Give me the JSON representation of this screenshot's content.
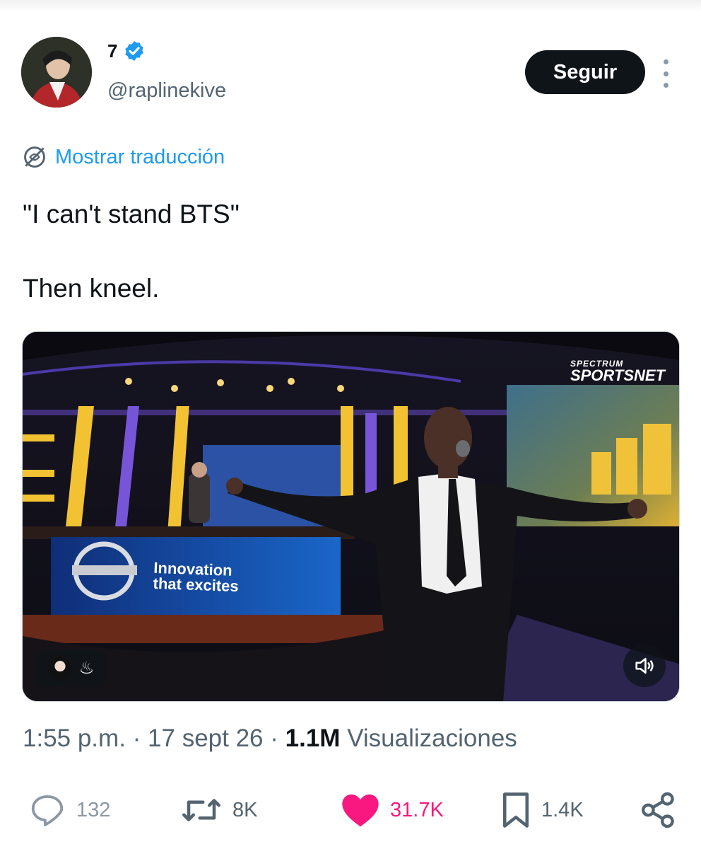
{
  "author": {
    "display_name": "7",
    "handle": "@raplinekive",
    "verified": true,
    "avatar_icon": "profile-avatar"
  },
  "follow_label": "Seguir",
  "translate_label": "Mostrar traducción",
  "tweet": {
    "line1": "\"I can't stand BTS\"",
    "line2": "Then kneel."
  },
  "media": {
    "brand_top": "SPECTRUM",
    "brand_bottom": "SPORTSNET",
    "desk_line1": "Innovation",
    "desk_line2": "that excites",
    "badge_emoji": "♨",
    "mute_icon": "speaker-muted-icon"
  },
  "meta": {
    "time": "1:55 p.m.",
    "date": "17 sept 26",
    "views_count": "1.1M",
    "views_label": "Visualizaciones",
    "separator": "·"
  },
  "actions": {
    "replies": "132",
    "retweets": "8K",
    "likes": "31.7K",
    "bookmarks": "1.4K"
  },
  "colors": {
    "accent": "#1d9bf0",
    "like": "#f91880",
    "text": "#0f1419",
    "muted": "#536471"
  }
}
